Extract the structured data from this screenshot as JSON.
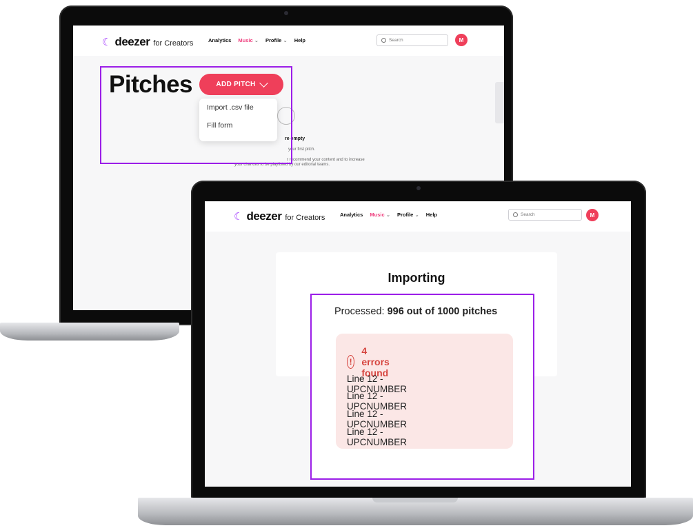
{
  "header": {
    "logo_text": "deezer",
    "logo_sub": "for Creators",
    "nav": {
      "analytics": "Analytics",
      "music": "Music",
      "profile": "Profile",
      "help": "Help"
    },
    "search_placeholder": "Search",
    "avatar_initial": "M"
  },
  "pitches_screen": {
    "title": "Pitches",
    "add_button": "ADD PITCH",
    "dropdown": [
      "Import .csv file",
      "Fill form"
    ],
    "empty_title": "re empty",
    "empty_line1": "your first pitch.",
    "empty_line2": "r recommend your content and to increase",
    "empty_line3": "your chances to be playlisted by our editorial teams."
  },
  "import_screen": {
    "title": "Importing",
    "processed_label": "Processed:",
    "processed_value": "996 out of 1000 pitches",
    "errors_title": "4 errors found",
    "error_icon_glyph": "!",
    "errors": [
      "Line 12 - UPCNUMBER",
      "Line 12 - UPCNUMBER",
      "Line 12 - UPCNUMBER",
      "Line 12 - UPCNUMBER"
    ]
  },
  "colors": {
    "accent_pink": "#ef3f5a",
    "music_active": "#ef3f7e",
    "highlight": "#9b1ee8",
    "error_red": "#d6453f",
    "error_bg": "#fbe7e6"
  }
}
